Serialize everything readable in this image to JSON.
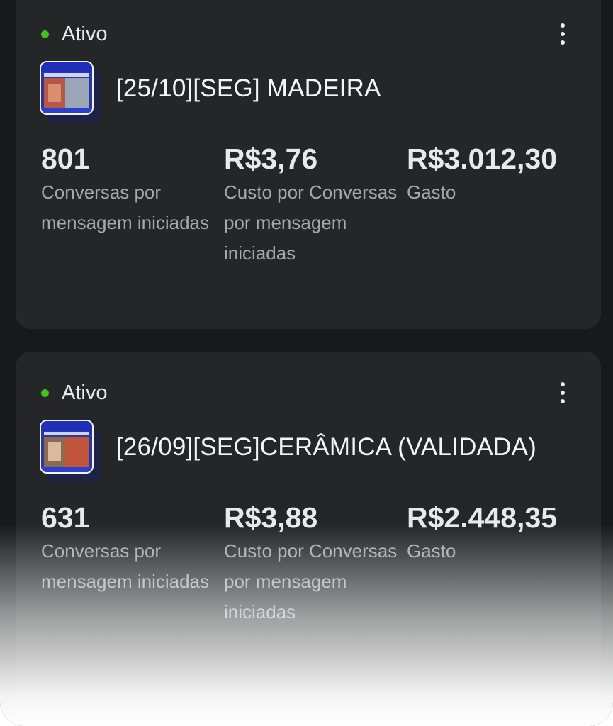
{
  "colors": {
    "status_active": "#43c21e",
    "card_background": "#252628"
  },
  "campaigns": [
    {
      "status": "Ativo",
      "title": "[25/10][SEG] MADEIRA",
      "thumbnail_icon": "ad-creative-thumbnail",
      "metrics": [
        {
          "value": "801",
          "label": "Conversas por mensagem iniciadas"
        },
        {
          "value": "R$3,76",
          "label": "Custo por Conversas por mensagem iniciadas"
        },
        {
          "value": "R$3.012,30",
          "label": "Gasto"
        }
      ]
    },
    {
      "status": "Ativo",
      "title": "[26/09][SEG]CERÂMICA (VALIDADA)",
      "thumbnail_icon": "ad-creative-thumbnail",
      "metrics": [
        {
          "value": "631",
          "label": "Conversas por mensagem iniciadas"
        },
        {
          "value": "R$3,88",
          "label": "Custo por Conversas por mensagem iniciadas"
        },
        {
          "value": "R$2.448,35",
          "label": "Gasto"
        }
      ]
    }
  ]
}
